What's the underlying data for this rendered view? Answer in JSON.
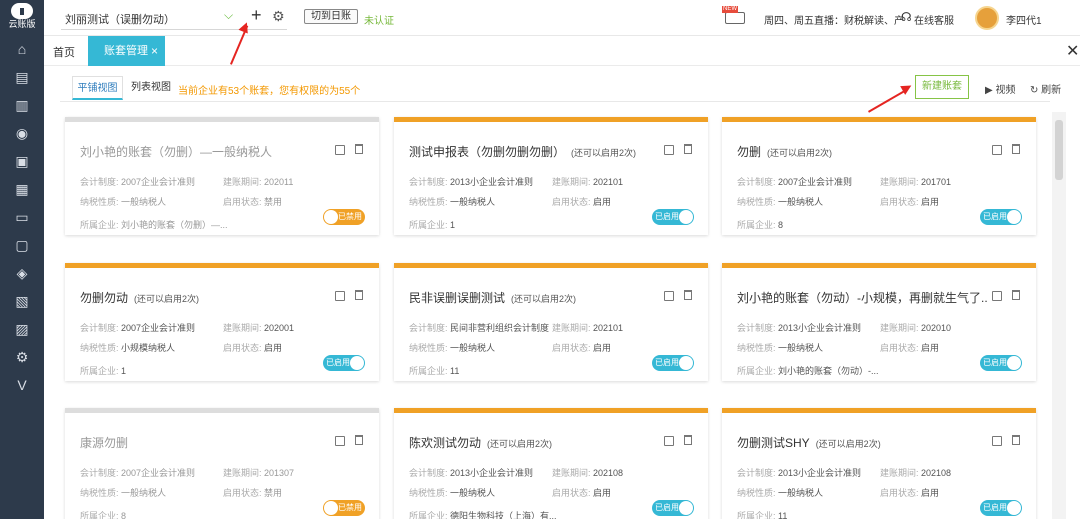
{
  "app": {
    "logo_text": "云账版"
  },
  "sidebar": {
    "icons": [
      "home-icon",
      "voucher-icon",
      "chart-icon",
      "money-icon",
      "ledger-icon",
      "report-icon",
      "bank-icon",
      "invoice-icon",
      "tax-icon",
      "assets-icon",
      "archive-icon",
      "settings-icon",
      "vip-icon"
    ]
  },
  "topbar": {
    "company_name": "刘丽测试（误删勿动）",
    "switch_label": "切到日账",
    "cert_status": "未认证",
    "live_text": "周四、周五直播：财税解读、产",
    "service_label": "在线客服",
    "user_name": "李四代1"
  },
  "tabs": {
    "home": "首页",
    "active": "账套管理",
    "close": "×"
  },
  "views": {
    "card_view": "平铺视图",
    "list_view": "列表视图"
  },
  "notice": "当前企业有53个账套，您有权限的为55个",
  "actions": {
    "new_set": "新建账套",
    "video": "视频",
    "refresh": "刷新"
  },
  "labels": {
    "standard": "会计制度:",
    "start_period": "建账期间:",
    "tax_type": "纳税性质:",
    "status": "启用状态:",
    "company": "所属企业:"
  },
  "cards": [
    {
      "title": "刘小艳的账套（勿删）—一般纳税人",
      "sub": "",
      "standard": "2007企业会计准则",
      "period": "202011",
      "tax": "一般纳税人",
      "status": "禁用",
      "company": "刘小艳的账套（勿删）—...",
      "toggle": "已禁用",
      "enabled": false
    },
    {
      "title": "测试申报表（勿删勿删勿删）",
      "sub": "(还可以启用2次)",
      "standard": "2013小企业会计准则",
      "period": "202101",
      "tax": "一般纳税人",
      "status": "启用",
      "company": "1",
      "toggle": "已启用",
      "enabled": true
    },
    {
      "title": "勿删",
      "sub": "(还可以启用2次)",
      "standard": "2007企业会计准则",
      "period": "201701",
      "tax": "一般纳税人",
      "status": "启用",
      "company": "8",
      "toggle": "已启用",
      "enabled": true
    },
    {
      "title": "勿删勿动",
      "sub": "(还可以启用2次)",
      "standard": "2007企业会计准则",
      "period": "202001",
      "tax": "小规模纳税人",
      "status": "启用",
      "company": "1",
      "toggle": "已启用",
      "enabled": true
    },
    {
      "title": "民非误删误删测试",
      "sub": "(还可以启用2次)",
      "standard": "民间非营利组织会计制度",
      "period": "202101",
      "tax": "一般纳税人",
      "status": "启用",
      "company": "11",
      "toggle": "已启用",
      "enabled": true
    },
    {
      "title": "刘小艳的账套（勿动）-小规模，再删就生气了...",
      "sub": "",
      "standard": "2013小企业会计准则",
      "period": "202010",
      "tax": "一般纳税人",
      "status": "启用",
      "company": "刘小艳的账套（勿动）-...",
      "toggle": "已启用",
      "enabled": true
    },
    {
      "title": "康源勿删",
      "sub": "",
      "standard": "2007企业会计准则",
      "period": "201307",
      "tax": "一般纳税人",
      "status": "禁用",
      "company": "8",
      "toggle": "已禁用",
      "enabled": false
    },
    {
      "title": "陈欢测试勿动",
      "sub": "(还可以启用2次)",
      "standard": "2013小企业会计准则",
      "period": "202108",
      "tax": "一般纳税人",
      "status": "启用",
      "company": "德阳生物科技（上海）有...",
      "toggle": "已启用",
      "enabled": true
    },
    {
      "title": "勿删测试SHY",
      "sub": "(还可以启用2次)",
      "standard": "2013小企业会计准则",
      "period": "202108",
      "tax": "一般纳税人",
      "status": "启用",
      "company": "11",
      "toggle": "已启用",
      "enabled": true
    }
  ]
}
